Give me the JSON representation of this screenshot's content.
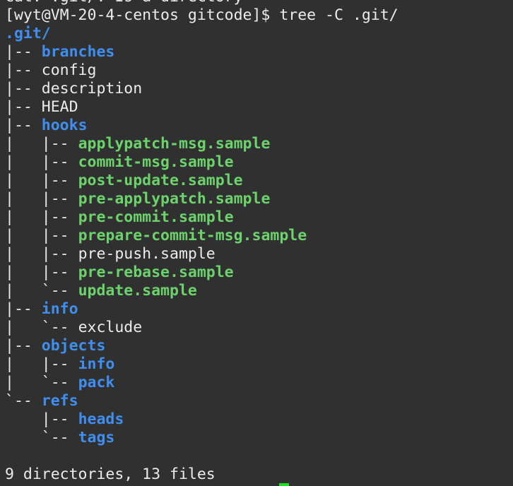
{
  "terminal": {
    "lines": [
      {
        "prefix": "",
        "name": "cat: .git/: Is a directory",
        "type": "file"
      },
      {
        "prefix": "",
        "name": "[wyt@VM-20-4-centos gitcode]$ tree -C .git/",
        "type": "file"
      },
      {
        "prefix": "",
        "name": ".git/",
        "type": "dir"
      },
      {
        "prefix": "|-- ",
        "name": "branches",
        "type": "dir"
      },
      {
        "prefix": "|-- ",
        "name": "config",
        "type": "file"
      },
      {
        "prefix": "|-- ",
        "name": "description",
        "type": "file"
      },
      {
        "prefix": "|-- ",
        "name": "HEAD",
        "type": "file"
      },
      {
        "prefix": "|-- ",
        "name": "hooks",
        "type": "dir"
      },
      {
        "prefix": "|   |-- ",
        "name": "applypatch-msg.sample",
        "type": "exec"
      },
      {
        "prefix": "|   |-- ",
        "name": "commit-msg.sample",
        "type": "exec"
      },
      {
        "prefix": "|   |-- ",
        "name": "post-update.sample",
        "type": "exec"
      },
      {
        "prefix": "|   |-- ",
        "name": "pre-applypatch.sample",
        "type": "exec"
      },
      {
        "prefix": "|   |-- ",
        "name": "pre-commit.sample",
        "type": "exec"
      },
      {
        "prefix": "|   |-- ",
        "name": "prepare-commit-msg.sample",
        "type": "exec"
      },
      {
        "prefix": "|   |-- ",
        "name": "pre-push.sample",
        "type": "file"
      },
      {
        "prefix": "|   |-- ",
        "name": "pre-rebase.sample",
        "type": "exec"
      },
      {
        "prefix": "|   `-- ",
        "name": "update.sample",
        "type": "exec"
      },
      {
        "prefix": "|-- ",
        "name": "info",
        "type": "dir"
      },
      {
        "prefix": "|   `-- ",
        "name": "exclude",
        "type": "file"
      },
      {
        "prefix": "|-- ",
        "name": "objects",
        "type": "dir"
      },
      {
        "prefix": "|   |-- ",
        "name": "info",
        "type": "dir"
      },
      {
        "prefix": "|   `-- ",
        "name": "pack",
        "type": "dir"
      },
      {
        "prefix": "`-- ",
        "name": "refs",
        "type": "dir"
      },
      {
        "prefix": "    |-- ",
        "name": "heads",
        "type": "dir"
      },
      {
        "prefix": "    `-- ",
        "name": "tags",
        "type": "dir"
      },
      {
        "prefix": "",
        "name": "",
        "type": "file"
      },
      {
        "prefix": "",
        "name": "9 directories, 13 files",
        "type": "file"
      }
    ]
  },
  "colors": {
    "background": "#303030",
    "directory": "#3f8ff0",
    "executable": "#6cd36c",
    "text": "#ececec",
    "cursor": "#22dd22"
  }
}
